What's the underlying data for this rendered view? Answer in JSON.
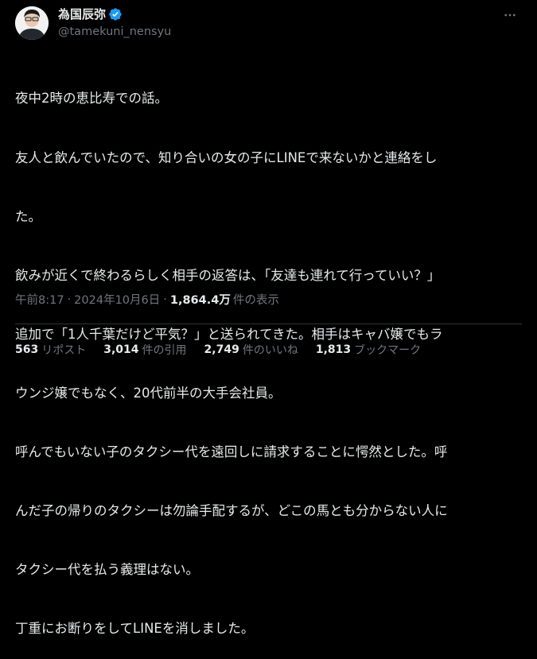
{
  "author": {
    "display_name": "為国辰弥",
    "handle": "@tamekuni_nensyu",
    "verified": true
  },
  "tweet": {
    "lines": [
      "夜中2時の恵比寿での話。",
      "友人と飲んでいたので、知り合いの女の子にLINEで来ないかと連絡をし",
      "た。",
      "飲みが近くで終わるらしく相手の返答は、「友達も連れて行っていい？」",
      "追加で「1人千葉だけど平気？」と送られてきた。相手はキャバ嬢でもラ",
      "ウンジ嬢でもなく、20代前半の大手会社員。",
      "呼んでもいない子のタクシー代を遠回しに請求することに愕然とした。呼",
      "んだ子の帰りのタクシーは勿論手配するが、どこの馬とも分からない人に",
      "タクシー代を払う義理はない。",
      "丁重にお断りをしてLINEを消しました。"
    ]
  },
  "meta": {
    "time": "午前8:17",
    "separator": "·",
    "date": "2024年10月6日",
    "views_count": "1,864.4万",
    "views_label": "件の表示"
  },
  "stats": {
    "reposts_count": "563",
    "reposts_label": "リポスト",
    "quotes_count": "3,014",
    "quotes_label": "件の引用",
    "likes_count": "2,749",
    "likes_label": "件のいいね",
    "bookmarks_count": "1,813",
    "bookmarks_label": "ブックマーク"
  },
  "colors": {
    "background": "#000000",
    "text_primary": "#e7e9ea",
    "text_secondary": "#71767b",
    "verified_badge": "#1d9bf0",
    "divider": "#2f3336"
  },
  "icons": {
    "verified": "verified-badge-icon",
    "more": "more-horizontal-icon"
  }
}
